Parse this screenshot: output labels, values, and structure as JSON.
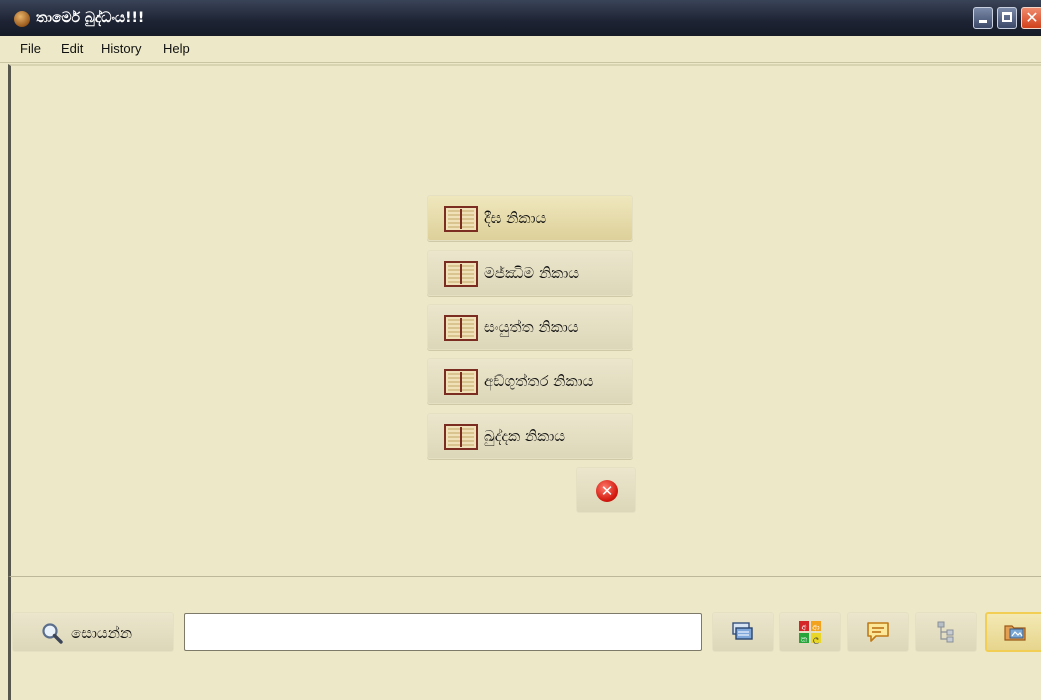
{
  "window": {
    "title": "තාමෙර් බුද්ධංය!!!",
    "controls": [
      "minimize",
      "maximize",
      "close"
    ]
  },
  "menu": {
    "file": "File",
    "edit": "Edit",
    "history": "History",
    "help": "Help"
  },
  "nikaya_buttons": [
    {
      "label": "දීඝ නිකාය",
      "active": true
    },
    {
      "label": "මජ්ඣිම නිකාය",
      "active": false
    },
    {
      "label": "සංයුත්ත නිකාය",
      "active": false
    },
    {
      "label": "අඞ්ගුත්තර නිකාය",
      "active": false
    },
    {
      "label": "ඛුද්දක නිකාය",
      "active": false
    }
  ],
  "close_panel": {
    "icon": "close-circle-icon"
  },
  "search": {
    "button_label": "සොයන්න",
    "input_value": "",
    "input_placeholder": ""
  },
  "toolbar_icons": [
    {
      "name": "documents-icon"
    },
    {
      "name": "sinhala-keyboard-icon"
    },
    {
      "name": "comment-icon"
    },
    {
      "name": "tree-view-icon"
    },
    {
      "name": "open-folder-icon",
      "highlighted": true
    }
  ],
  "colors": {
    "background": "#ede9c8",
    "titlebar": "#1d2333",
    "book_border": "#7a2d20",
    "close_red": "#d31a10",
    "highlight_border": "#f2cf54"
  }
}
